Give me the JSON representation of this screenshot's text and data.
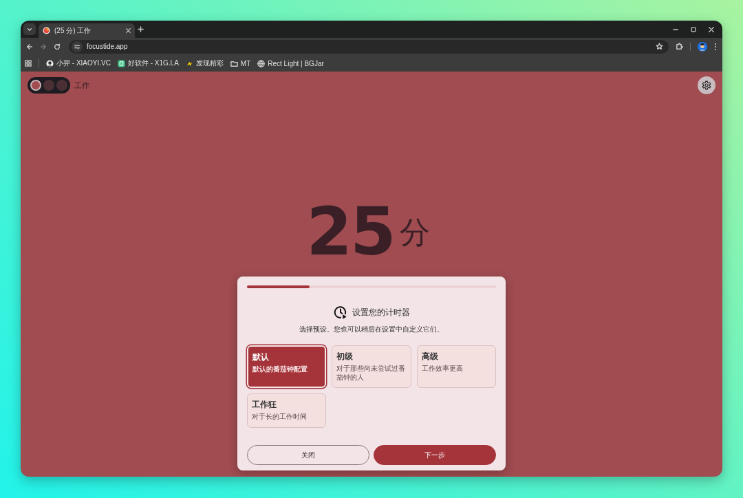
{
  "browser": {
    "tabs": [
      {
        "title": "(25 分) 工作",
        "selected": true
      }
    ],
    "address": "focustide.app",
    "bookmarks": [
      {
        "label": "小羿 - XIAOYI.VC",
        "kind": "avatar"
      },
      {
        "label": "好软件 - X1G.LA",
        "kind": "badge"
      },
      {
        "label": "发现精彩",
        "kind": "spark"
      },
      {
        "label": "MT",
        "kind": "folder"
      },
      {
        "label": "Rect Light | BGJar",
        "kind": "globe"
      }
    ]
  },
  "app": {
    "modes": [
      {
        "selected": true
      },
      {
        "selected": false
      },
      {
        "selected": false
      }
    ],
    "mode_label": "工作",
    "timer": {
      "value": "25",
      "unit": "分"
    }
  },
  "dialog": {
    "progress": {
      "level": 0.25
    },
    "title": "设置您的计时器",
    "subtitle": "选择预设。您也可以稍后在设置中自定义它们。",
    "presets": [
      {
        "name": "默认",
        "description": "默认的番茄钟配置",
        "selected": true
      },
      {
        "name": "初级",
        "description": "对于那些尚未尝试过番茄钟的人",
        "selected": false
      },
      {
        "name": "高级",
        "description": "工作效率更高",
        "selected": false
      },
      {
        "name": "工作狂",
        "description": "对于长的工作时间",
        "selected": false
      }
    ],
    "buttons": [
      {
        "label": "关闭",
        "kind": "secondary"
      },
      {
        "label": "下一步",
        "kind": "primary"
      }
    ]
  }
}
